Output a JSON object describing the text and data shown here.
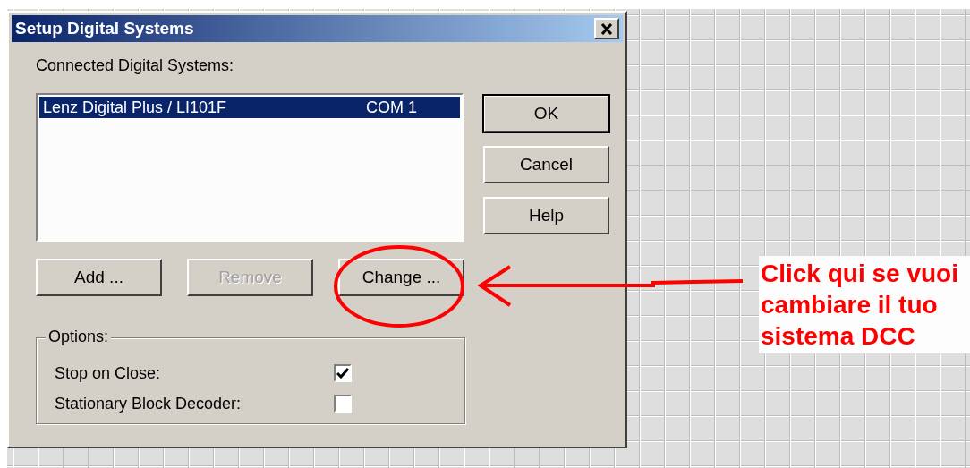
{
  "window": {
    "title": "Setup Digital Systems"
  },
  "systems_label": "Connected Digital Systems:",
  "systems": [
    {
      "name": "Lenz Digital Plus / LI101F",
      "port": "COM 1",
      "selected": true
    }
  ],
  "dialog_buttons": [
    {
      "label": "OK",
      "default": true
    },
    {
      "label": "Cancel",
      "default": false
    },
    {
      "label": "Help",
      "default": false
    }
  ],
  "list_buttons": [
    {
      "label": "Add ...",
      "disabled": false
    },
    {
      "label": "Remove",
      "disabled": true
    },
    {
      "label": "Change ...",
      "disabled": false
    }
  ],
  "options": {
    "title": "Options:",
    "items": [
      {
        "label": "Stop on Close:",
        "checked": true
      },
      {
        "label": "Stationary Block Decoder:",
        "checked": false
      }
    ]
  },
  "annotation": {
    "text": "Click qui se vuoi cambiare il tuo sistema DCC"
  }
}
